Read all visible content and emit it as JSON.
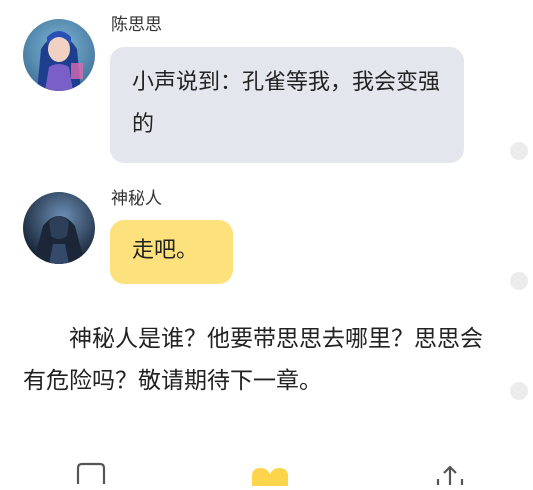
{
  "messages": [
    {
      "sender": "陈思思",
      "text": "小声说到：孔雀等我，我会变强的",
      "bubble_color": "#e3e7ed"
    },
    {
      "sender": "神秘人",
      "text": "走吧。",
      "bubble_color": "#fde17d"
    }
  ],
  "narration": "神秘人是谁？他要带思思去哪里？思思会有危险吗？敬请期待下一章。",
  "bottom_bar": {
    "icons": [
      "comment-icon",
      "heart-icon",
      "share-icon"
    ],
    "heart_color": "#fcd54b"
  }
}
